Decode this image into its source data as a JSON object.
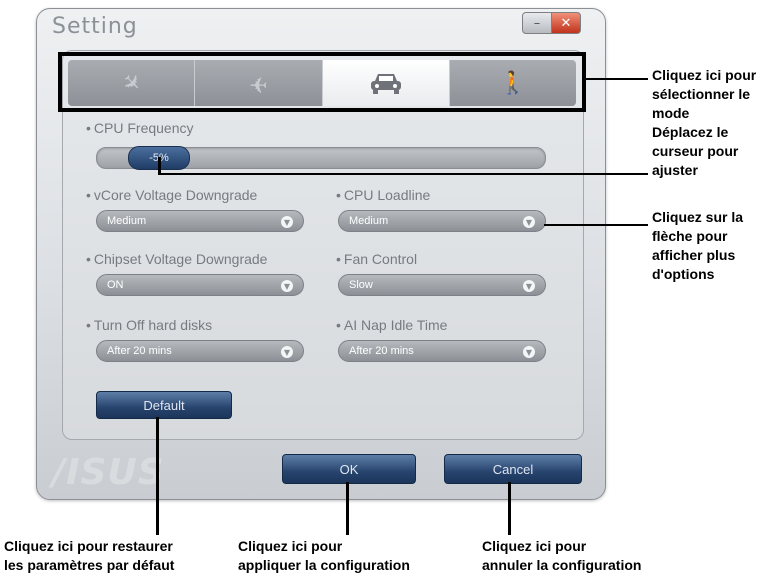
{
  "window": {
    "title": "Setting",
    "minimize_glyph": "–",
    "close_glyph": "✕"
  },
  "tabs": [
    {
      "icon": "plane-takeoff-icon",
      "glyph": "✈",
      "active": false
    },
    {
      "icon": "plane-icon",
      "glyph": "✈",
      "active": false
    },
    {
      "icon": "car-icon",
      "glyph": "🚗",
      "active": true
    },
    {
      "icon": "walking-person-icon",
      "glyph": "🚶",
      "active": false
    }
  ],
  "cpu_frequency": {
    "label": "CPU Frequency",
    "value": "-5%"
  },
  "vcore": {
    "label": "vCore Voltage Downgrade",
    "value": "Medium"
  },
  "cpu_loadline": {
    "label": "CPU Loadline",
    "value": "Medium"
  },
  "chipset": {
    "label": "Chipset Voltage Downgrade",
    "value": "ON"
  },
  "fan_control": {
    "label": "Fan Control",
    "value": "Slow"
  },
  "hdd_off": {
    "label": "Turn Off hard disks",
    "value": "After 20 mins"
  },
  "ai_nap": {
    "label": "AI Nap Idle Time",
    "value": "After 20 mins"
  },
  "buttons": {
    "default": "Default",
    "ok": "OK",
    "cancel": "Cancel"
  },
  "logo": "/ISUS",
  "arrow_glyph": "▼",
  "annotations": {
    "mode": "Cliquez ici pour\nsélectionner le\nmode",
    "slider": "Déplacez le\ncurseur pour\najuster",
    "arrow": "Cliquez sur la\nflèche pour\nafficher plus\nd'options",
    "default": "Cliquez ici pour restaurer\nles paramètres par défaut",
    "ok": "Cliquez ici pour\nappliquer la  configuration",
    "cancel": "Cliquez ici pour\nannuler la configuration"
  }
}
